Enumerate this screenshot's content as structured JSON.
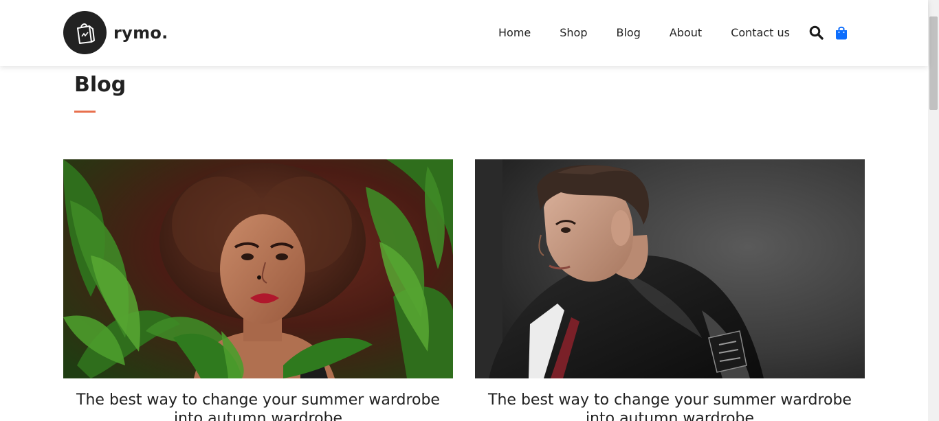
{
  "brand": {
    "name": "rymo."
  },
  "nav": {
    "items": [
      "Home",
      "Shop",
      "Blog",
      "About",
      "Contact us"
    ],
    "search_icon": "search-icon",
    "cart_icon": "shopping-bag-icon"
  },
  "page": {
    "title": "Blog"
  },
  "colors": {
    "accent": "#e8704d",
    "cart": "#0d6efd",
    "text": "#212121"
  },
  "posts": [
    {
      "title": "The best way to change your summer wardrobe into autumn wardrobe",
      "image": "woman with curly hair among green leaves"
    },
    {
      "title": "The best way to change your summer wardrobe into autumn wardrobe",
      "image": "young man in black leather jacket"
    }
  ]
}
